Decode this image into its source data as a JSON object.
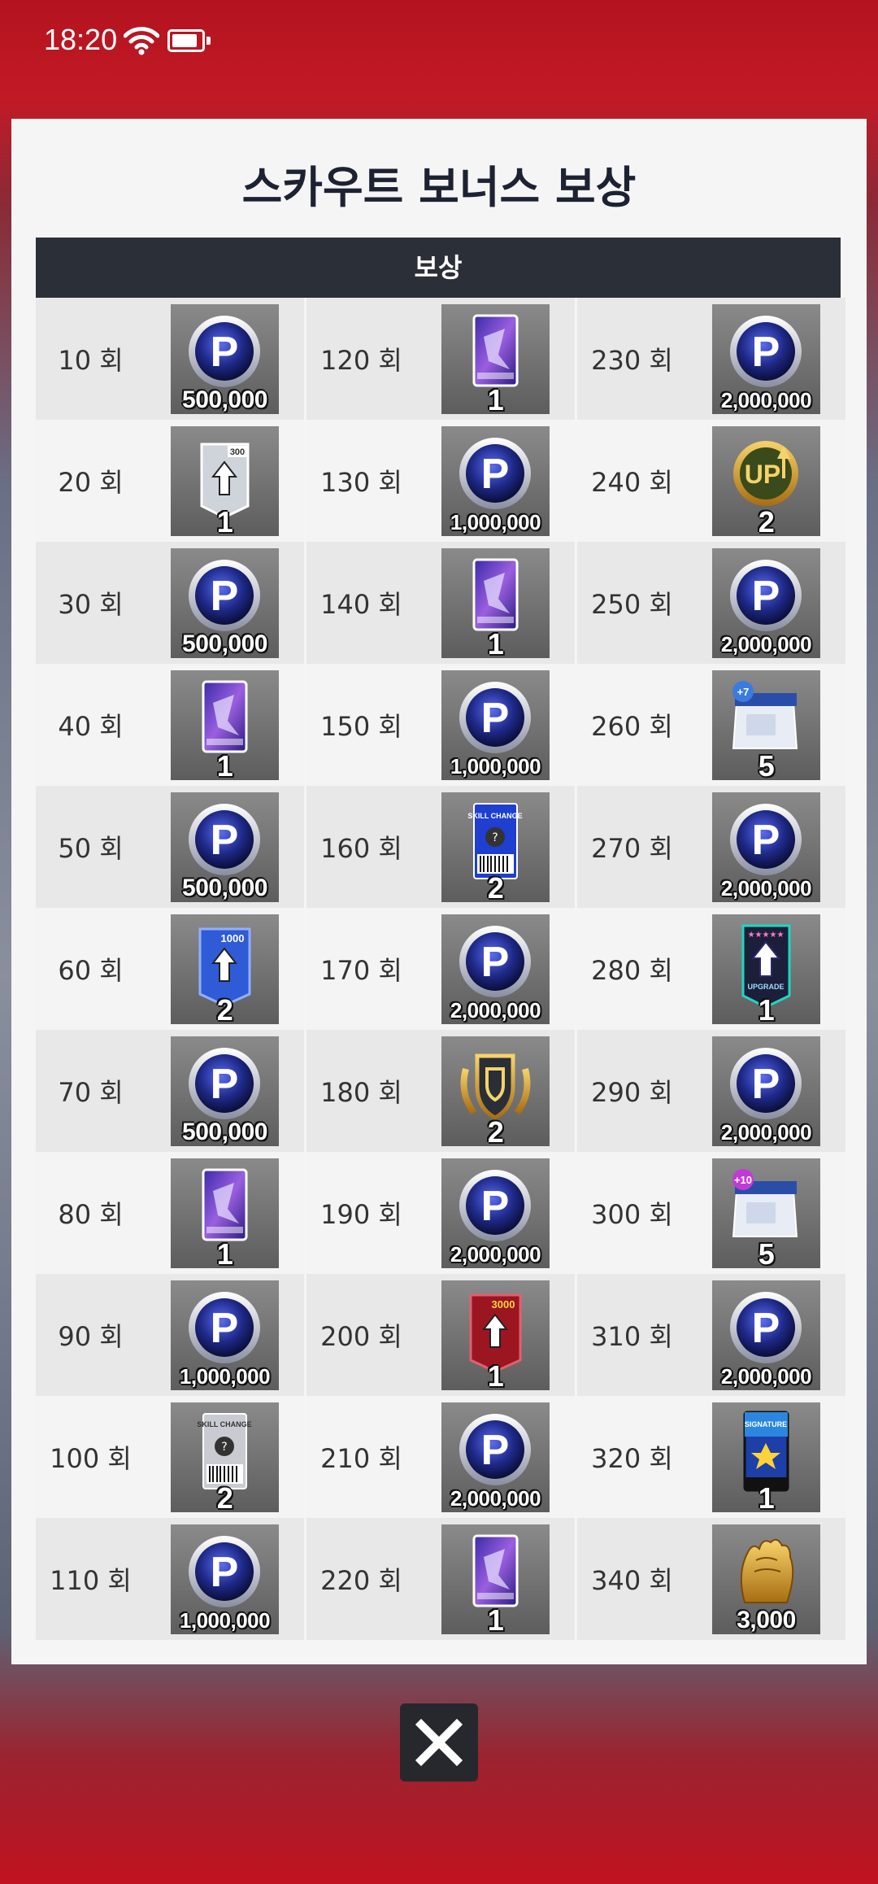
{
  "status": {
    "time": "18:20"
  },
  "dialog": {
    "title": "스카우트 보너스 보상",
    "header": "보상",
    "rows": [
      [
        {
          "count": "10 회",
          "icon": "p-coin-icon",
          "qty": "500,000"
        },
        {
          "count": "120 회",
          "icon": "player-pack-icon",
          "qty": "1"
        },
        {
          "count": "230 회",
          "icon": "p-coin-icon",
          "qty": "2,000,000"
        }
      ],
      [
        {
          "count": "20 회",
          "icon": "exp-card-300-icon",
          "qty": "1"
        },
        {
          "count": "130 회",
          "icon": "p-coin-icon",
          "qty": "1,000,000"
        },
        {
          "count": "240 회",
          "icon": "up-badge-icon",
          "qty": "2"
        }
      ],
      [
        {
          "count": "30 회",
          "icon": "p-coin-icon",
          "qty": "500,000"
        },
        {
          "count": "140 회",
          "icon": "player-pack-icon",
          "qty": "1"
        },
        {
          "count": "250 회",
          "icon": "p-coin-icon",
          "qty": "2,000,000"
        }
      ],
      [
        {
          "count": "40 회",
          "icon": "player-pack-icon",
          "qty": "1"
        },
        {
          "count": "150 회",
          "icon": "p-coin-icon",
          "qty": "1,000,000"
        },
        {
          "count": "260 회",
          "icon": "training-box-plus7-icon",
          "qty": "5"
        }
      ],
      [
        {
          "count": "50 회",
          "icon": "p-coin-icon",
          "qty": "500,000"
        },
        {
          "count": "160 회",
          "icon": "skill-change-ticket-icon",
          "qty": "2"
        },
        {
          "count": "270 회",
          "icon": "p-coin-icon",
          "qty": "2,000,000"
        }
      ],
      [
        {
          "count": "60 회",
          "icon": "exp-card-1000-icon",
          "qty": "2"
        },
        {
          "count": "170 회",
          "icon": "p-coin-icon",
          "qty": "2,000,000"
        },
        {
          "count": "280 회",
          "icon": "upgrade-card-icon",
          "qty": "1"
        }
      ],
      [
        {
          "count": "70 회",
          "icon": "p-coin-icon",
          "qty": "500,000"
        },
        {
          "count": "180 회",
          "icon": "shield-badge-icon",
          "qty": "2"
        },
        {
          "count": "290 회",
          "icon": "p-coin-icon",
          "qty": "2,000,000"
        }
      ],
      [
        {
          "count": "80 회",
          "icon": "player-pack-icon",
          "qty": "1"
        },
        {
          "count": "190 회",
          "icon": "p-coin-icon",
          "qty": "2,000,000"
        },
        {
          "count": "300 회",
          "icon": "training-box-plus10-icon",
          "qty": "5"
        }
      ],
      [
        {
          "count": "90 회",
          "icon": "p-coin-icon",
          "qty": "1,000,000"
        },
        {
          "count": "200 회",
          "icon": "exp-card-3000-icon",
          "qty": "1"
        },
        {
          "count": "310 회",
          "icon": "p-coin-icon",
          "qty": "2,000,000"
        }
      ],
      [
        {
          "count": "100 회",
          "icon": "skill-change-silver-icon",
          "qty": "2"
        },
        {
          "count": "210 회",
          "icon": "p-coin-icon",
          "qty": "2,000,000"
        },
        {
          "count": "320 회",
          "icon": "signature-card-icon",
          "qty": "1"
        }
      ],
      [
        {
          "count": "110 회",
          "icon": "p-coin-icon",
          "qty": "1,000,000"
        },
        {
          "count": "220 회",
          "icon": "player-pack-icon",
          "qty": "1"
        },
        {
          "count": "340 회",
          "icon": "golden-glove-icon",
          "qty": "3,000"
        }
      ]
    ]
  },
  "colors": {
    "header_bg": "#2b2f37",
    "coin_blue": "#1f2a8a",
    "pack_purple": "#4a2aa8",
    "card_red": "#9b1620",
    "gold": "#d9a22a"
  }
}
